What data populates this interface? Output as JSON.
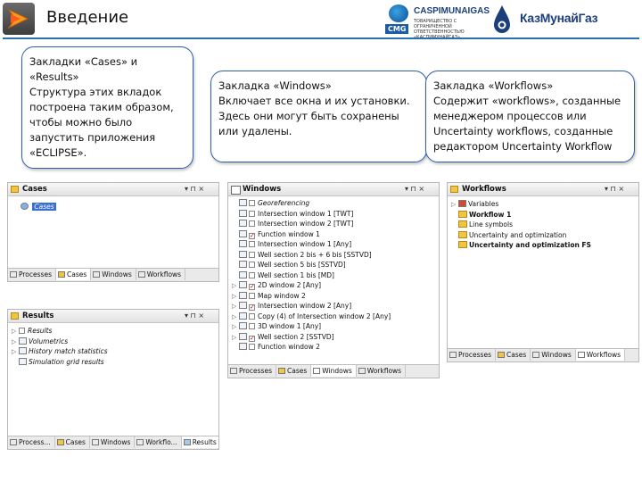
{
  "header": {
    "title": "Введение",
    "brand1": {
      "name": "CASPIMUNAIGAS",
      "tag": "CMG",
      "subtitle": "ТОВАРИЩЕСТВО С ОГРАНИЧЕННОЙ ОТВЕТСТВЕННОСТЬЮ «КАСПИМУНАЙГАЗ»"
    },
    "brand2": "КазМунайГаз"
  },
  "bubbles": {
    "cases_results": [
      "Закладки «Cases» и «Results»",
      "Структура этих вкладок построена таким образом, чтобы можно было запустить приложения «ECLIPSE»."
    ],
    "windows": [
      "Закладка «Windows»",
      "Включает все окна и их установки. Здесь они могут быть сохранены или удалены."
    ],
    "workflows": [
      "Закладка «Workflows»",
      "Содержит «workflows», созданные менеджером процессов или Uncertainty workflows, созданные редактором Uncertainty Workflow"
    ]
  },
  "panels": {
    "cases": {
      "title": "Cases",
      "controls": "▾ ⊓ ×",
      "items": [
        "Cases"
      ],
      "tabs": [
        "Processes",
        "Cases",
        "Windows",
        "Workflows"
      ]
    },
    "results": {
      "title": "Results",
      "controls": "▾ ⊓ ×",
      "items": [
        "Results",
        "Volumetrics",
        "History match statistics",
        "Simulation grid results"
      ],
      "tabs": [
        "Process...",
        "Cases",
        "Windows",
        "Workflo...",
        "Results"
      ]
    },
    "windows": {
      "title": "Windows",
      "controls": "▾ ⊓ ×",
      "items": [
        "Georeferencing",
        "Intersection window 1 [TWT]",
        "Intersection window 2 [TWT]",
        "Function window 1",
        "Intersection window 1 [Any]",
        "Well section 2 bis + 6 bis [SSTVD]",
        "Well section 5 bis [SSTVD]",
        "Well section 1 bis [MD]",
        "2D window 2 [Any]",
        "Map window 2",
        "Intersection window 2 [Any]",
        "Copy (4) of Intersection window 2 [Any]",
        "3D window 1 [Any]",
        "Well section 2 [SSTVD]",
        "Function window 2"
      ],
      "tabs": [
        "Processes",
        "Cases",
        "Windows",
        "Workflows"
      ]
    },
    "workflows": {
      "title": "Workflows",
      "controls": "▾ ⊓ ×",
      "items": [
        "Variables",
        "Workflow 1",
        "Line symbols",
        "Uncertainty and optimization",
        "Uncertainty and optimization FS"
      ],
      "tabs": [
        "Processes",
        "Cases",
        "Windows",
        "Workflows"
      ]
    }
  },
  "colors": {
    "accent": "#2c6fb5",
    "selection": "#3a6fd0",
    "bubble_border": "#2f5ea8"
  }
}
